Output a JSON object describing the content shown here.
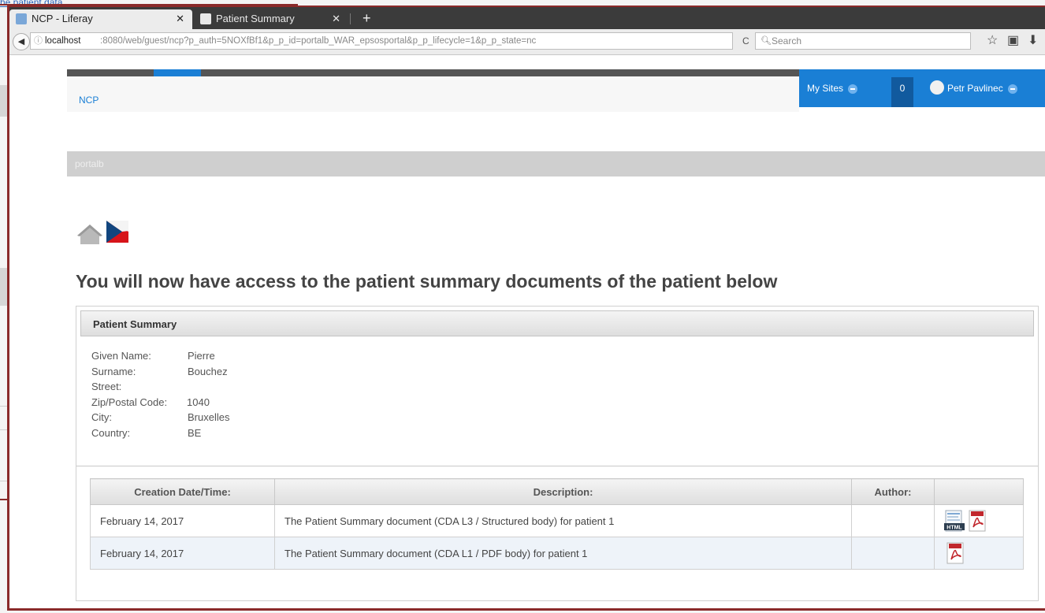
{
  "background": {
    "link_text": "he patient data"
  },
  "browser": {
    "tabs": [
      {
        "label": "NCP - Liferay",
        "active": true
      },
      {
        "label": "Patient Summary",
        "active": false
      }
    ],
    "url_host": "localhost",
    "url_path": ":8080/web/guest/ncp?p_auth=5NOXfBf1&p_p_id=portalb_WAR_epsosportal&p_p_lifecycle=1&p_p_state=nc",
    "search_placeholder": "Search"
  },
  "dockbar": {
    "my_sites": "My Sites",
    "notifications": "0",
    "user_name": "Petr Pavlinec"
  },
  "site": {
    "title": "NCP",
    "portlet_title": "portalb"
  },
  "main": {
    "heading": "You will now have access to the patient summary documents of the patient below"
  },
  "patient_summary": {
    "title": "Patient Summary",
    "fields": [
      {
        "label": "Given Name:",
        "value": "Pierre"
      },
      {
        "label": "Surname:",
        "value": "Bouchez"
      },
      {
        "label": "Street:",
        "value": ""
      },
      {
        "label": "Zip/Postal Code:",
        "value": "1040"
      },
      {
        "label": "City:",
        "value": "Bruxelles"
      },
      {
        "label": "Country:",
        "value": "BE"
      }
    ]
  },
  "documents": {
    "columns": [
      "Creation Date/Time:",
      "Description:",
      "Author:",
      ""
    ],
    "rows": [
      {
        "date": "February 14, 2017",
        "description": "The Patient Summary document (CDA L3 / Structured body) for patient 1",
        "author": "",
        "formats": [
          "html-icon",
          "pdf-icon"
        ]
      },
      {
        "date": "February 14, 2017",
        "description": "The Patient Summary document (CDA L1 / PDF body) for patient 1",
        "author": "",
        "formats": [
          "pdf-icon"
        ]
      }
    ]
  }
}
